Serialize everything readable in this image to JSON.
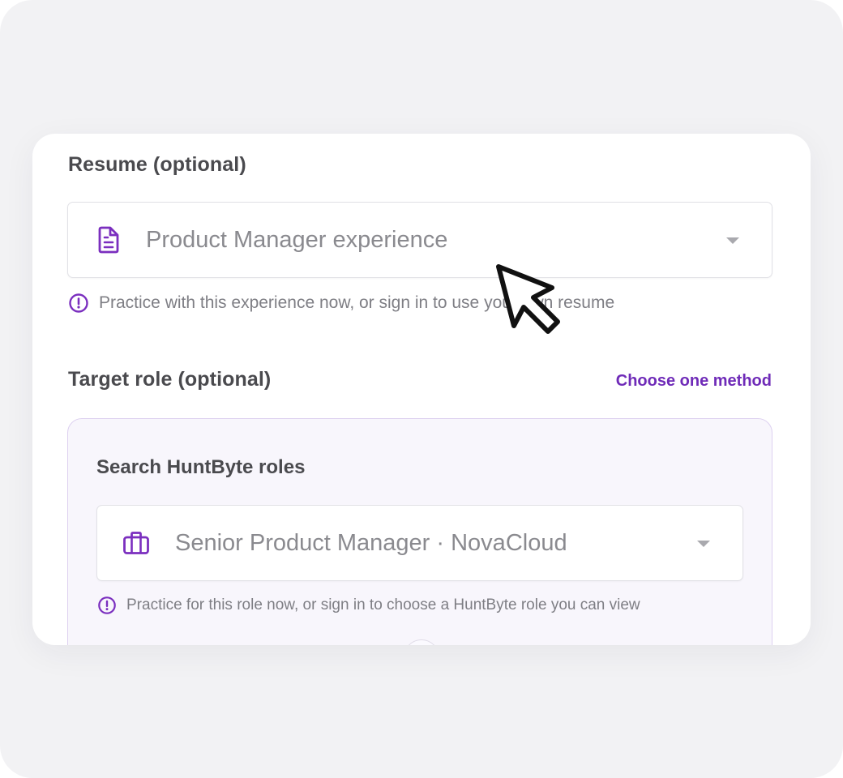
{
  "resume": {
    "label": "Resume (optional)",
    "select_value": "Product Manager experience",
    "hint": "Practice with this experience now, or sign in to use your own resume",
    "icon": "document-icon"
  },
  "target_role": {
    "label": "Target role (optional)",
    "choose_link": "Choose one method",
    "panel_title": "Search HuntByte roles",
    "select_value": "Senior Product Manager · NovaCloud",
    "hint": "Practice for this role now, or sign in to choose a HuntByte role you can view",
    "icon": "briefcase-icon"
  },
  "colors": {
    "accent": "#6f2bb8",
    "icon_purple": "#7b2fbf",
    "panel_bg": "#f8f6fc",
    "panel_border": "#ddd0f0",
    "frame_bg": "#f2f2f4"
  }
}
